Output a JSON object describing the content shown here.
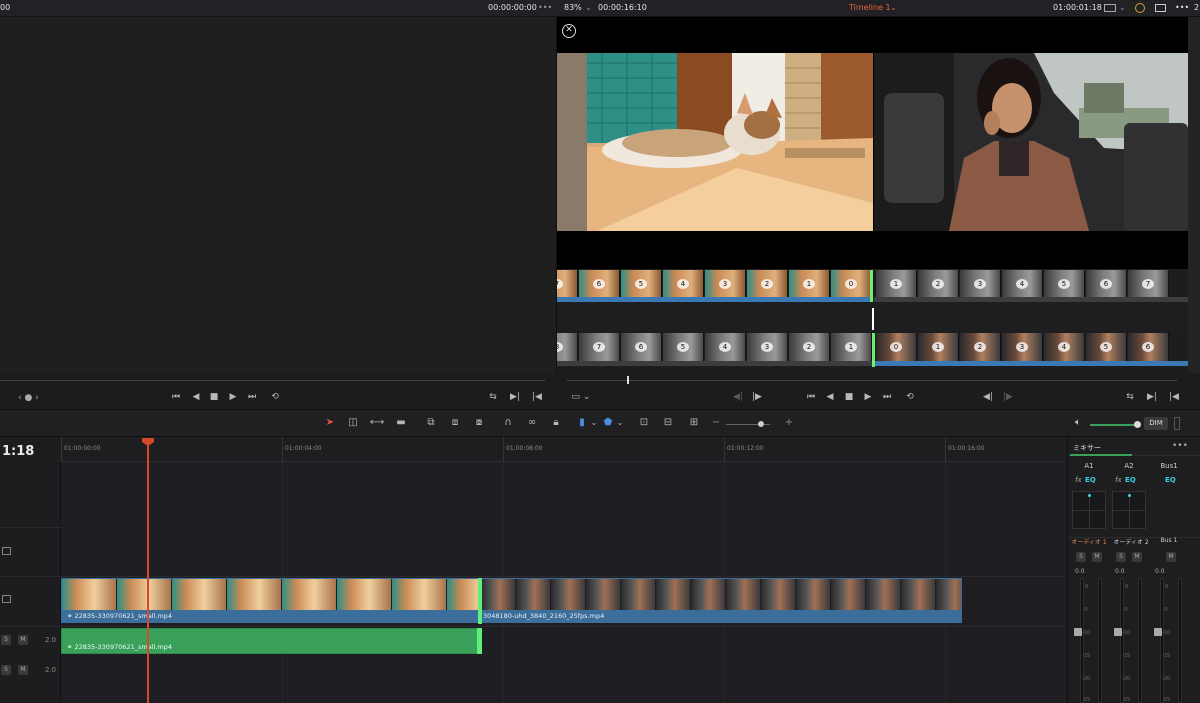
{
  "header": {
    "source_timecode": "00:00:00:00",
    "zoom": "83%",
    "duration": "00:00:16:10",
    "timeline_name": "Timeline 1",
    "record_timecode": "01:00:01:18",
    "left_edge_text": "00"
  },
  "viewer": {
    "close_icon": "close-circle-icon",
    "trim_strip_top_labels": [
      "7",
      "6",
      "5",
      "4",
      "3",
      "2",
      "1",
      "0",
      "1",
      "2",
      "3",
      "4",
      "5",
      "6",
      "7"
    ],
    "trim_strip_bottom_labels": [
      "8",
      "7",
      "6",
      "5",
      "4",
      "3",
      "2",
      "1",
      "0",
      "1",
      "2",
      "3",
      "4",
      "5",
      "6"
    ]
  },
  "timeline": {
    "current_timecode": "1:18",
    "ruler_labels": [
      "01:00:00:00",
      "01:00:04:00",
      "01:00:08:00",
      "01:00:12:00",
      "01:00:16:00"
    ],
    "video_clip_1_name": "22835-330970621_small.mp4",
    "video_clip_2_name": "3048180-uhd_3840_2160_25fps.mp4",
    "audio_clip_1_name": "22835-330970621_small.mp4",
    "track_buttons": {
      "solo": "S",
      "mute": "M"
    },
    "track_volume_1": "2.0",
    "track_volume_2": "2.0"
  },
  "toolbar": {
    "dim_label": "DIM"
  },
  "mixer": {
    "title": "ミキサー",
    "more_icon": "ellipsis-icon",
    "channels": [
      "A1",
      "A2",
      "Bus1"
    ],
    "fx_label": "fx",
    "eq_label": "EQ",
    "channel_names": [
      "オーディオ 1",
      "オーディオ 2",
      "Bus 1"
    ],
    "solo": "S",
    "mute": "M",
    "level_readouts": [
      "0.0",
      "0.0",
      "0.0"
    ],
    "scale": [
      "0",
      "-5",
      "-10",
      "-15",
      "-20",
      "-25"
    ]
  },
  "colors": {
    "accent_red": "#d9482b",
    "video_clip_blue": "#3c6e9c",
    "audio_clip_green": "#3aa15a",
    "timeline_name_orange": "#e8643c"
  }
}
